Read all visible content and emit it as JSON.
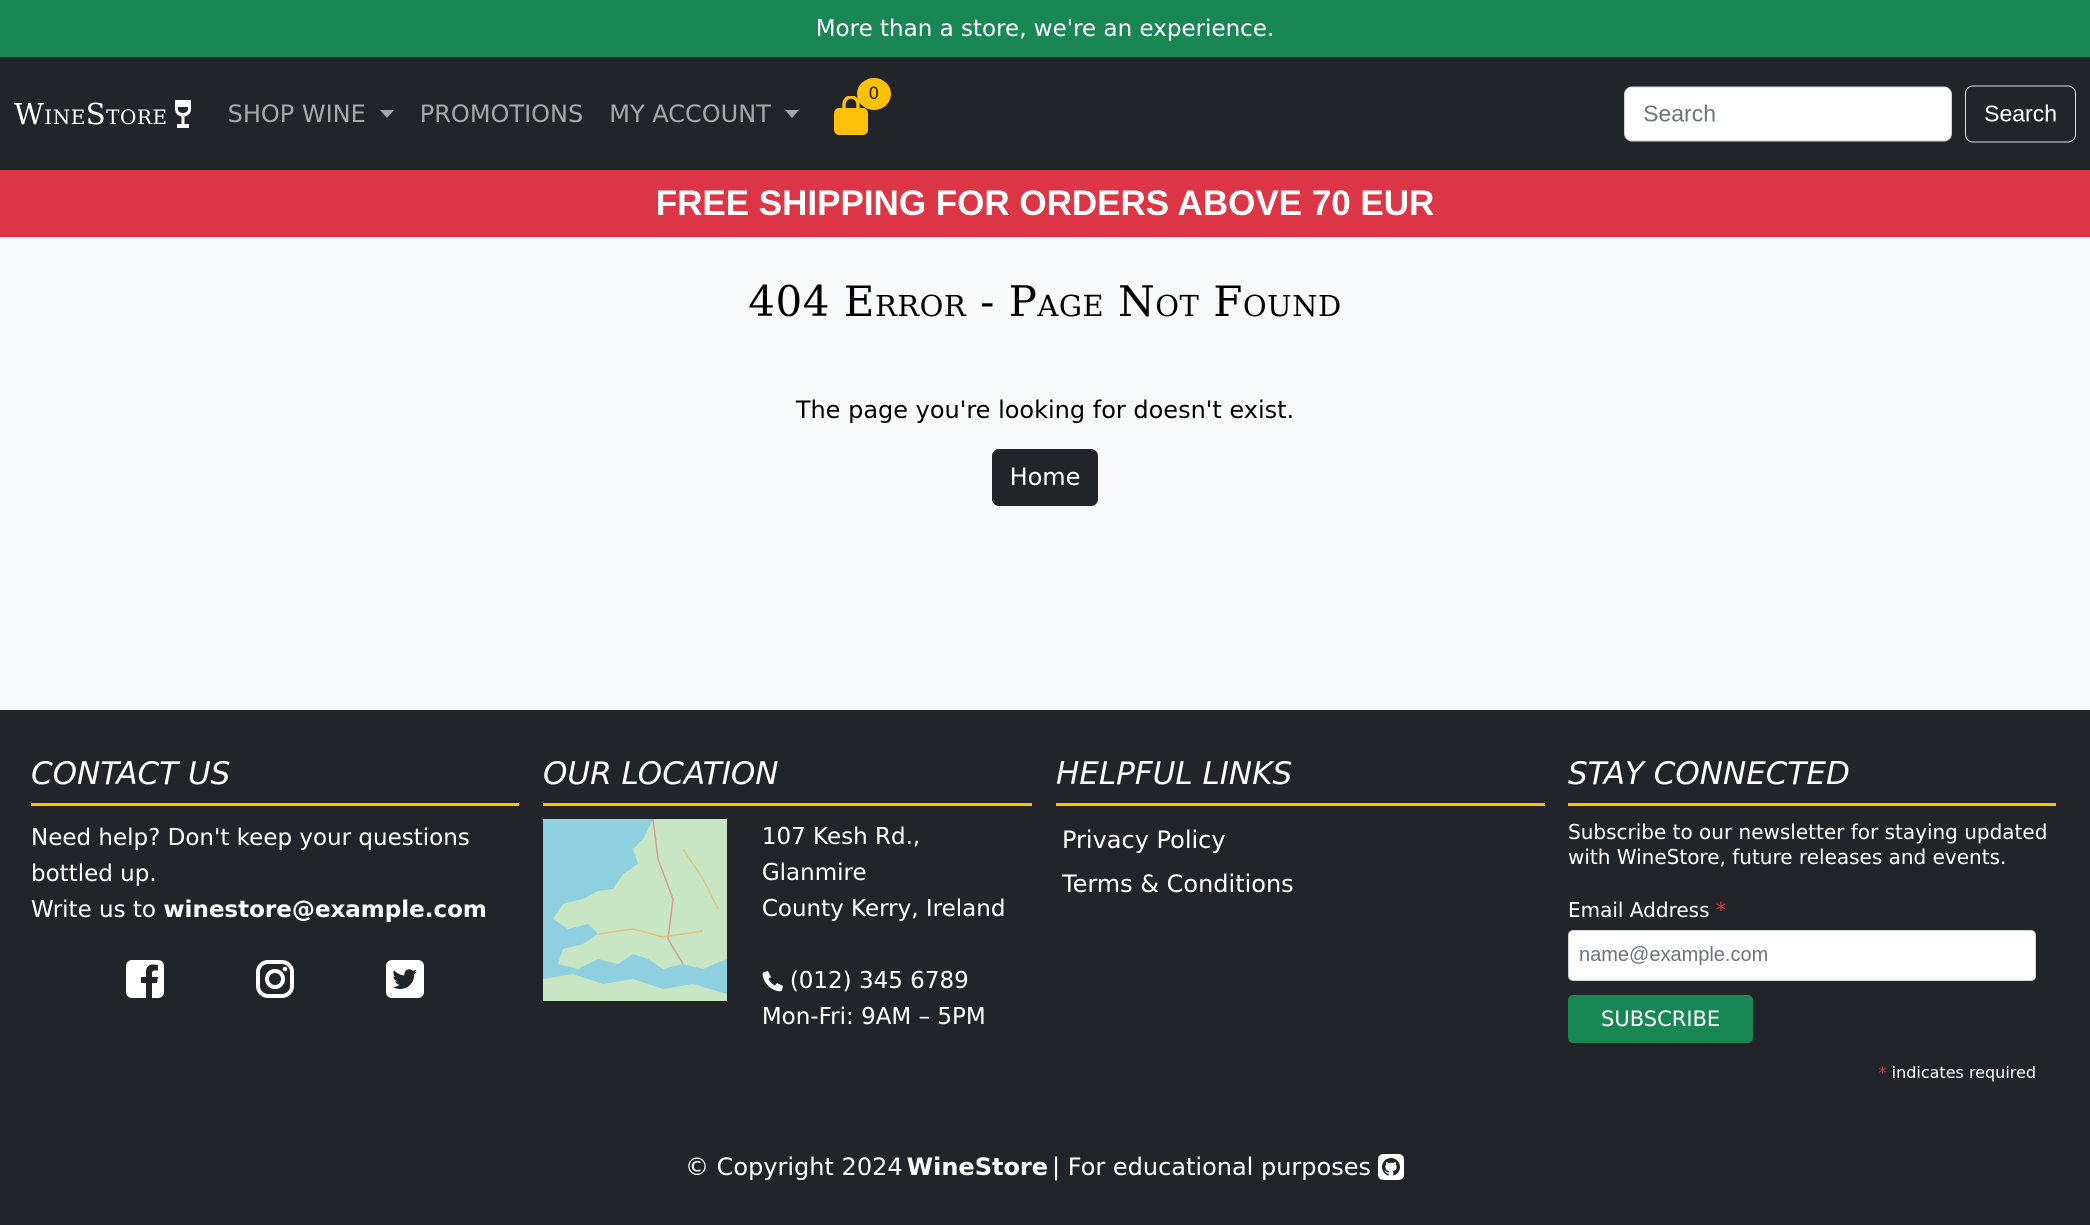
{
  "topbar": {
    "text": "More than a store, we're an experience."
  },
  "nav": {
    "brand": "WineStore",
    "items": [
      "SHOP WINE",
      "PROMOTIONS",
      "MY ACCOUNT"
    ],
    "cart_count": "0",
    "search_placeholder": "Search",
    "search_button": "Search"
  },
  "shipping_banner": "FREE SHIPPING FOR ORDERS ABOVE 70 EUR",
  "main": {
    "title": "404 Error - Page Not Found",
    "message": "The page you're looking for doesn't exist.",
    "home_button": "Home"
  },
  "footer": {
    "contact": {
      "heading": "Contact Us",
      "line1": "Need help? Don't keep your questions bottled up.",
      "line2_prefix": "Write us to",
      "email": "winestore@example.com",
      "socials": [
        "facebook-icon",
        "instagram-icon",
        "twitter-icon"
      ]
    },
    "location": {
      "heading": "Our Location",
      "address1": "107 Kesh Rd., Glanmire",
      "address2": "County Kerry, Ireland",
      "phone": "(012) 345 6789",
      "hours": "Mon-Fri: 9AM – 5PM"
    },
    "links": {
      "heading": "Helpful Links",
      "items": [
        "Privacy Policy",
        "Terms & Conditions"
      ]
    },
    "newsletter": {
      "heading": "Stay Connected",
      "text": "Subscribe to our newsletter for staying updated with WineStore, future releases and events.",
      "email_label": "Email Address",
      "email_placeholder": "name@example.com",
      "button": "SUBSCRIBE",
      "required_note": "indicates required"
    },
    "copyright": {
      "prefix": "© Copyright 2024",
      "brand": "WineStore",
      "suffix": "| For educational purposes"
    }
  },
  "colors": {
    "green": "#198754",
    "dark": "#212529",
    "red": "#dc3545",
    "yellow": "#ffc107"
  }
}
